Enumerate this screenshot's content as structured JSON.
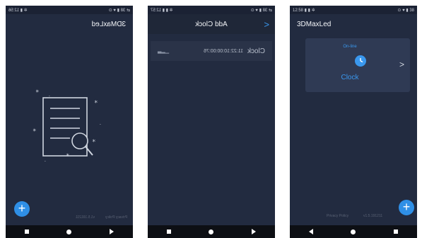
{
  "screen1": {
    "status_left": "⇄ 38 ▮ ♥ ⊙",
    "status_right": "✲ ▮ 12:56",
    "title": "3DMaxLed",
    "footer_privacy": "Privacy Policy",
    "footer_version": "v1.5.191211"
  },
  "screen2": {
    "status_left": "⇄ 38 ▮ ♥ ⊙",
    "status_right": "✲ ▮ ▮ 12:57",
    "title": "Add Clock",
    "row_label": "Clock",
    "row_mac": "11:22:10:00:00:76"
  },
  "screen3": {
    "status_left": "12:58 ▮ ▮ ✲",
    "status_right": "⊙ ♥ ▮ 38",
    "title": "3DMaxLed",
    "card_status": "On-line",
    "card_name": "Clock",
    "footer_privacy": "Privacy Policy",
    "footer_version": "v1.5.191211"
  },
  "colors": {
    "background": "#222b40",
    "accent": "#2f8fe6",
    "card": "#2f3a54"
  }
}
